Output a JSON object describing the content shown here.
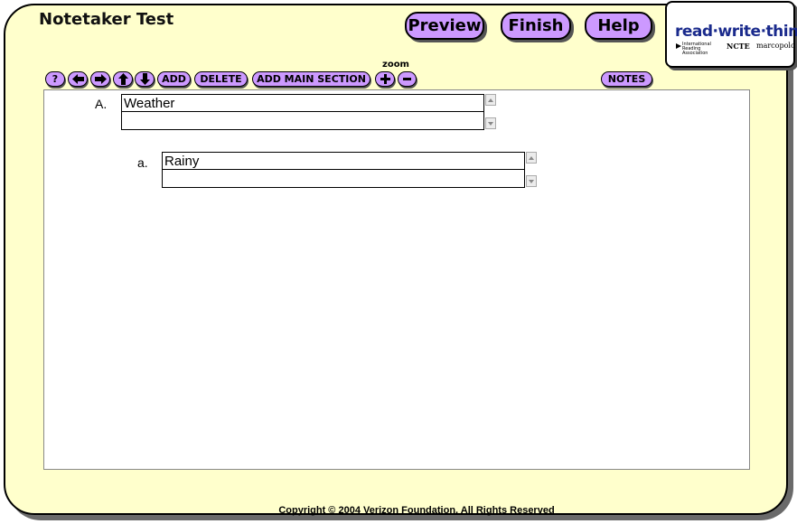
{
  "app": {
    "title": "Notetaker Test"
  },
  "nav": {
    "preview_label": "Preview",
    "finish_label": "Finish",
    "help_label": "Help"
  },
  "logo": {
    "main": "read·write·think",
    "ira": "International Reading Association",
    "ncte": "NCTE",
    "marcopolo": "marcopolo"
  },
  "toolbar": {
    "help_label": "?",
    "add_label": "ADD",
    "delete_label": "DELETE",
    "add_main_section_label": "ADD MAIN SECTION",
    "zoom_label": "zoom",
    "notes_label": "NOTES",
    "icons": [
      "question-icon",
      "arrow-left-icon",
      "arrow-right-icon",
      "arrow-up-icon",
      "arrow-down-icon",
      "zoom-in-icon",
      "zoom-out-icon"
    ]
  },
  "outline": {
    "sections": [
      {
        "letter": "A.",
        "title": "Weather",
        "notes": "",
        "subsections": [
          {
            "letter": "a.",
            "title": "Rainy",
            "notes": ""
          }
        ]
      }
    ]
  },
  "colors": {
    "background": "#ffffcc",
    "button": "#cc99ff",
    "logo_text": "#1a2a8c"
  },
  "footer": {
    "copyright": "Copyright © 2004 Verizon Foundation.  All Rights Reserved"
  }
}
